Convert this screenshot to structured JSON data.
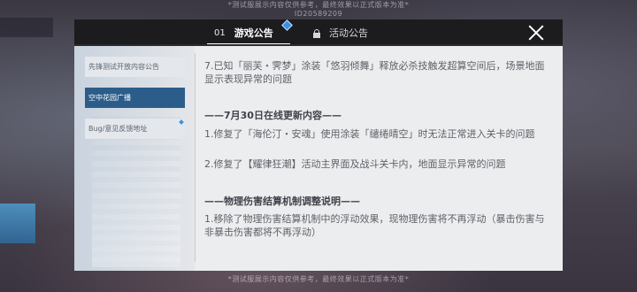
{
  "watermark": {
    "text": "*测试服展示内容仅供参考，最终效果以正式版本为准*",
    "id": "ID20589209"
  },
  "tabs": [
    {
      "number": "01",
      "label": "游戏公告",
      "active": true
    },
    {
      "label": "活动公告",
      "active": false,
      "icon": "lock-icon"
    }
  ],
  "close": {
    "icon": "close-icon"
  },
  "sidebar": {
    "items": [
      {
        "label": "先锋测试开放内容公告",
        "active": false,
        "new": false
      },
      {
        "label": "空中花园广播",
        "active": true,
        "new": false
      },
      {
        "label": "Bug/意见反馈地址",
        "active": false,
        "new": true
      }
    ]
  },
  "content": {
    "para1": "7.已知「丽芙・霁梦」涂装「悠羽倾舞」释放必杀技触发超算空间后，场景地面显示表现异常的问题",
    "heading1": "——7月30日在线更新内容——",
    "item1": "1.修复了「海伦汀・安魂」使用涂装「缱绻晴空」时无法正常进入关卡的问题",
    "item2": "2.修复了【耀律狂潮】活动主界面及战斗关卡内，地面显示异常的问题",
    "heading2": "——物理伤害结算机制调整说明——",
    "item3": "1.移除了物理伤害结算机制中的浮动效果，现物理伤害将不再浮动（暴击伤害与非暴击伤害都将不再浮动）"
  },
  "colors": {
    "header": "#1c1c1e",
    "panel": "#ecedef",
    "accent": "#2c5d8a",
    "new_dot": "#3d8fe0"
  }
}
